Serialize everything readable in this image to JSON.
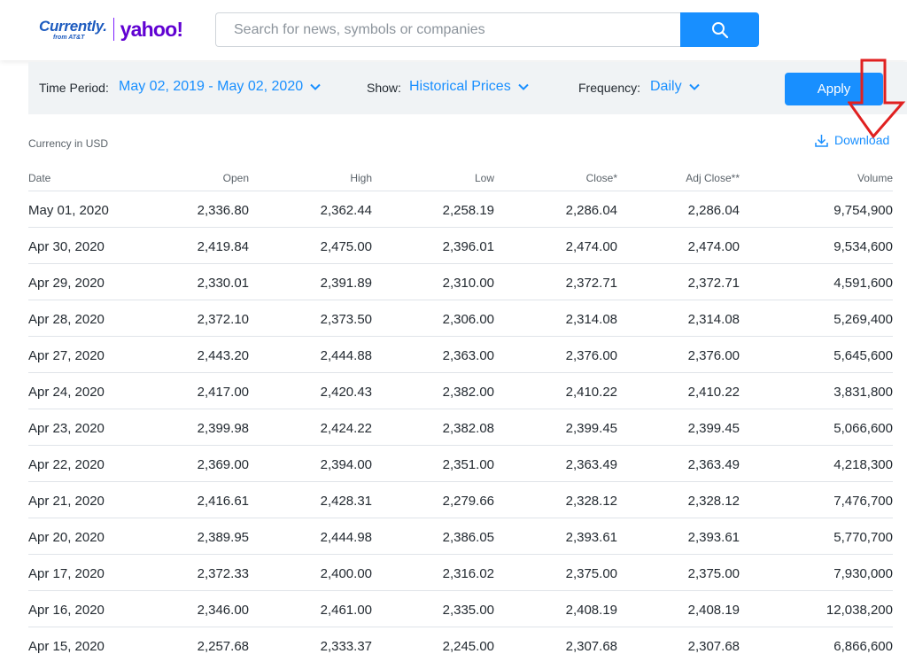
{
  "header": {
    "logo_currently": "Currently.",
    "logo_currently_sub": "from AT&T",
    "logo_yahoo": "yahoo!",
    "search_placeholder": "Search for news, symbols or companies",
    "search_icon": "search-icon"
  },
  "filters": {
    "time_period_label": "Time Period:",
    "time_period_value": "May 02, 2019 - May 02, 2020",
    "show_label": "Show:",
    "show_value": "Historical Prices",
    "frequency_label": "Frequency:",
    "frequency_value": "Daily",
    "apply_label": "Apply"
  },
  "currency_note": "Currency in USD",
  "download_label": "Download",
  "colors": {
    "accent": "#188fff",
    "filter_bg": "#f0f3f5",
    "annotation_arrow": "#e02020"
  },
  "table": {
    "headers": [
      "Date",
      "Open",
      "High",
      "Low",
      "Close*",
      "Adj Close**",
      "Volume"
    ],
    "rows": [
      [
        "May 01, 2020",
        "2,336.80",
        "2,362.44",
        "2,258.19",
        "2,286.04",
        "2,286.04",
        "9,754,900"
      ],
      [
        "Apr 30, 2020",
        "2,419.84",
        "2,475.00",
        "2,396.01",
        "2,474.00",
        "2,474.00",
        "9,534,600"
      ],
      [
        "Apr 29, 2020",
        "2,330.01",
        "2,391.89",
        "2,310.00",
        "2,372.71",
        "2,372.71",
        "4,591,600"
      ],
      [
        "Apr 28, 2020",
        "2,372.10",
        "2,373.50",
        "2,306.00",
        "2,314.08",
        "2,314.08",
        "5,269,400"
      ],
      [
        "Apr 27, 2020",
        "2,443.20",
        "2,444.88",
        "2,363.00",
        "2,376.00",
        "2,376.00",
        "5,645,600"
      ],
      [
        "Apr 24, 2020",
        "2,417.00",
        "2,420.43",
        "2,382.00",
        "2,410.22",
        "2,410.22",
        "3,831,800"
      ],
      [
        "Apr 23, 2020",
        "2,399.98",
        "2,424.22",
        "2,382.08",
        "2,399.45",
        "2,399.45",
        "5,066,600"
      ],
      [
        "Apr 22, 2020",
        "2,369.00",
        "2,394.00",
        "2,351.00",
        "2,363.49",
        "2,363.49",
        "4,218,300"
      ],
      [
        "Apr 21, 2020",
        "2,416.61",
        "2,428.31",
        "2,279.66",
        "2,328.12",
        "2,328.12",
        "7,476,700"
      ],
      [
        "Apr 20, 2020",
        "2,389.95",
        "2,444.98",
        "2,386.05",
        "2,393.61",
        "2,393.61",
        "5,770,700"
      ],
      [
        "Apr 17, 2020",
        "2,372.33",
        "2,400.00",
        "2,316.02",
        "2,375.00",
        "2,375.00",
        "7,930,000"
      ],
      [
        "Apr 16, 2020",
        "2,346.00",
        "2,461.00",
        "2,335.00",
        "2,408.19",
        "2,408.19",
        "12,038,200"
      ],
      [
        "Apr 15, 2020",
        "2,257.68",
        "2,333.37",
        "2,245.00",
        "2,307.68",
        "2,307.68",
        "6,866,600"
      ]
    ]
  }
}
